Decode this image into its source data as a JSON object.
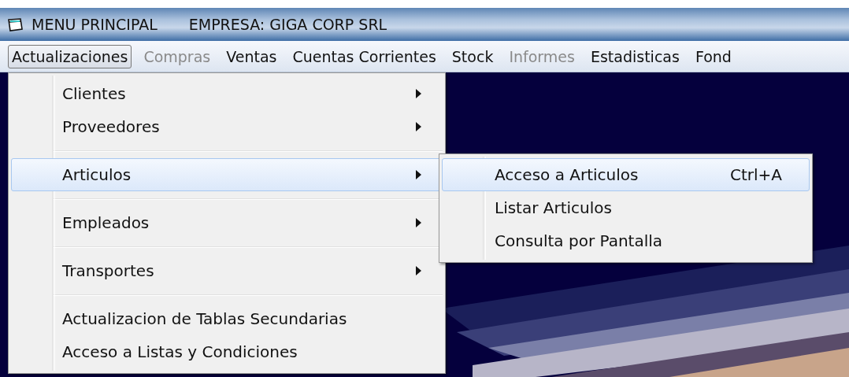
{
  "title_bar": {
    "title": "MENU PRINCIPAL",
    "company": "EMPRESA: GIGA CORP SRL"
  },
  "menubar": {
    "items": [
      {
        "label": "Actualizaciones",
        "selected": true,
        "disabled": false
      },
      {
        "label": "Compras",
        "selected": false,
        "disabled": true
      },
      {
        "label": "Ventas",
        "selected": false,
        "disabled": false
      },
      {
        "label": "Cuentas Corrientes",
        "selected": false,
        "disabled": false
      },
      {
        "label": "Stock",
        "selected": false,
        "disabled": false
      },
      {
        "label": "Informes",
        "selected": false,
        "disabled": true
      },
      {
        "label": "Estadisticas",
        "selected": false,
        "disabled": false
      },
      {
        "label": "Fond",
        "selected": false,
        "disabled": false
      }
    ]
  },
  "dropdown": {
    "items": [
      {
        "kind": "item",
        "label": "Clientes",
        "submenu": true,
        "selected": false
      },
      {
        "kind": "item",
        "label": "Proveedores",
        "submenu": true,
        "selected": false
      },
      {
        "kind": "separator"
      },
      {
        "kind": "item",
        "label": "Articulos",
        "submenu": true,
        "selected": true
      },
      {
        "kind": "separator"
      },
      {
        "kind": "item",
        "label": "Empleados",
        "submenu": true,
        "selected": false
      },
      {
        "kind": "separator"
      },
      {
        "kind": "item",
        "label": "Transportes",
        "submenu": true,
        "selected": false
      },
      {
        "kind": "separator"
      },
      {
        "kind": "item",
        "label": "Actualizacion de Tablas Secundarias",
        "submenu": false,
        "selected": false
      },
      {
        "kind": "item",
        "label": "Acceso a Listas y Condiciones",
        "submenu": false,
        "selected": false
      }
    ]
  },
  "submenu": {
    "items": [
      {
        "label": "Acceso a Articulos",
        "shortcut": "Ctrl+A",
        "selected": true
      },
      {
        "label": "Listar Articulos",
        "selected": false
      },
      {
        "label": "Consulta por Pantalla",
        "selected": false
      }
    ]
  }
}
